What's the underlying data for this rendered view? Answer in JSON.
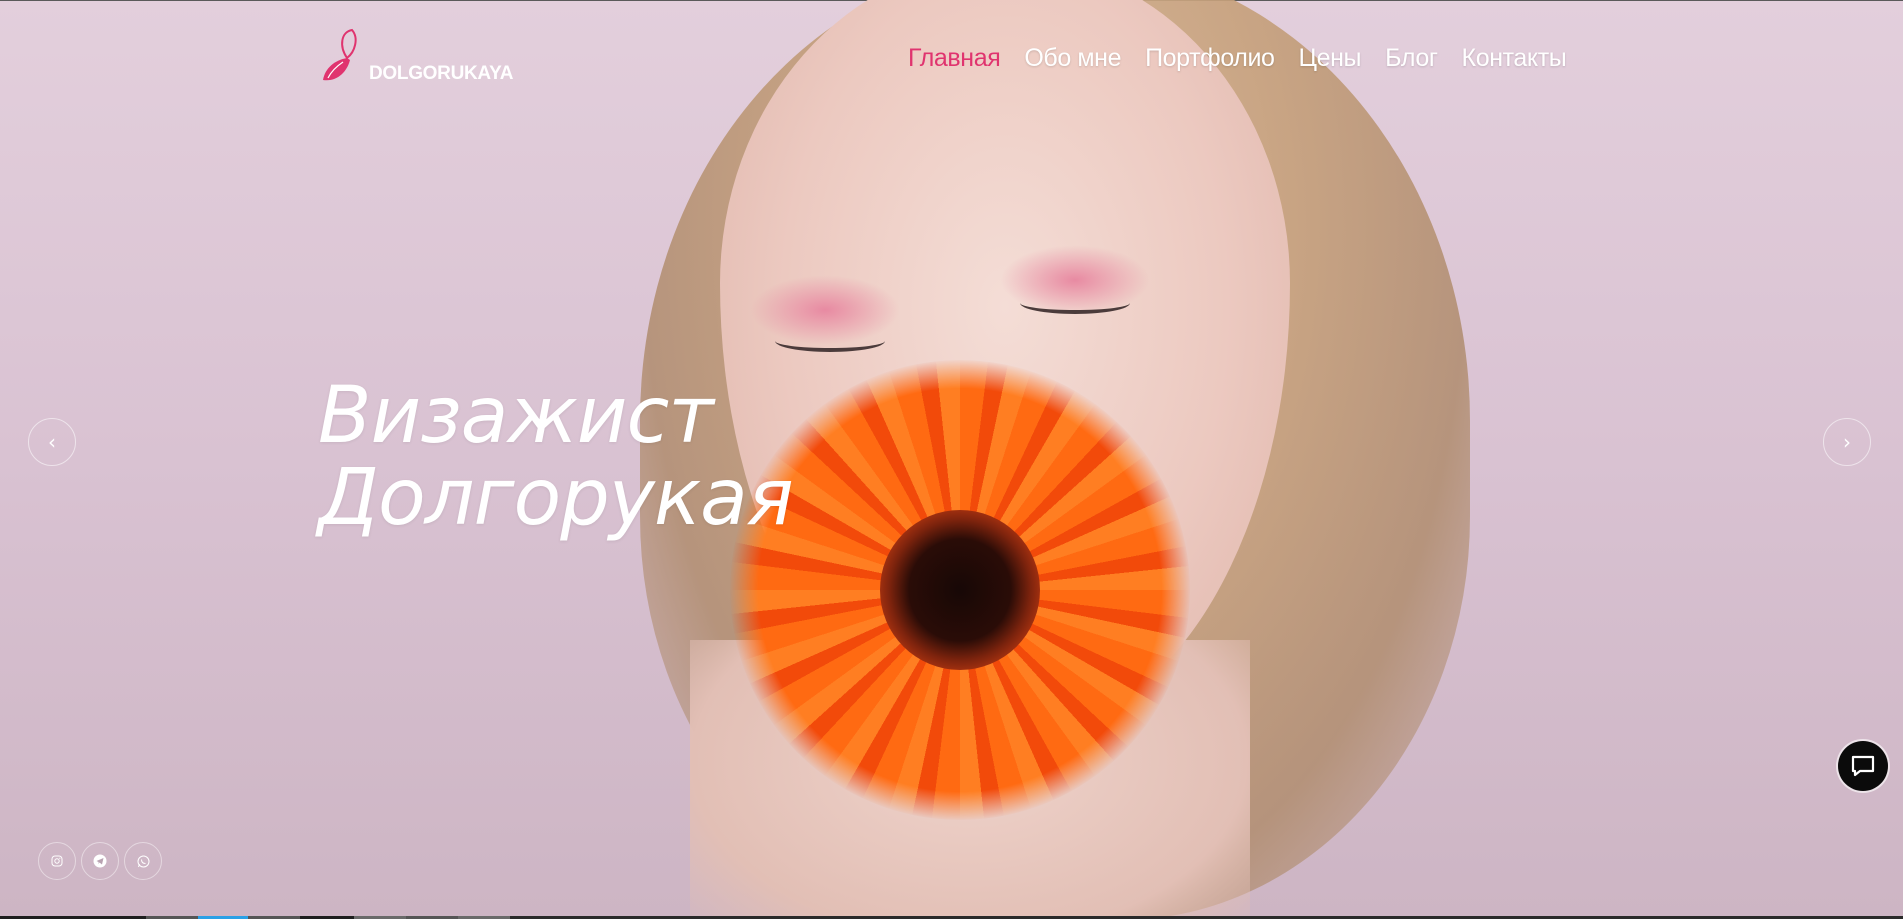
{
  "brand": {
    "logo_text": "DOLGORUKAYA",
    "accent_color": "#e0346f"
  },
  "nav": {
    "items": [
      {
        "label": "Главная",
        "active": true
      },
      {
        "label": "Обо мне",
        "active": false
      },
      {
        "label": "Портфолио",
        "active": false
      },
      {
        "label": "Цены",
        "active": false
      },
      {
        "label": "Блог",
        "active": false
      },
      {
        "label": "Контакты",
        "active": false
      }
    ]
  },
  "hero": {
    "title_line1": "Визажист",
    "title_line2": "Долгорукая"
  },
  "slider": {
    "prev_icon": "chevron-left-icon",
    "next_icon": "chevron-right-icon",
    "prev_glyph": "‹",
    "next_glyph": "›"
  },
  "social": [
    {
      "icon": "instagram-icon"
    },
    {
      "icon": "telegram-icon"
    },
    {
      "icon": "whatsapp-icon"
    }
  ],
  "chat": {
    "icon": "chat-bubble-icon"
  }
}
